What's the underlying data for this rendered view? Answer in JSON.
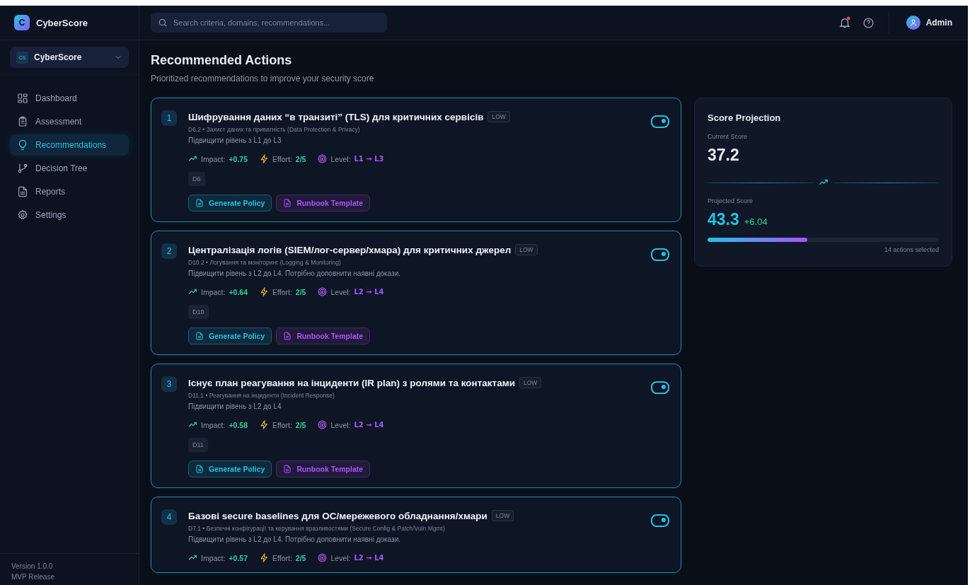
{
  "brand": {
    "logo_letter": "C",
    "name": "CyberScore"
  },
  "workspace": {
    "badge": "CS",
    "name": "CyberScore"
  },
  "sidebar": {
    "items": [
      {
        "label": "Dashboard",
        "selected": false
      },
      {
        "label": "Assessment",
        "selected": false
      },
      {
        "label": "Recommendations",
        "selected": true
      },
      {
        "label": "Decision Tree",
        "selected": false
      },
      {
        "label": "Reports",
        "selected": false
      },
      {
        "label": "Settings",
        "selected": false
      }
    ],
    "footer": [
      "Version 1.0.0",
      "MVP Release"
    ]
  },
  "search": {
    "placeholder": "Search criteria, domains, recommendations..."
  },
  "topbar": {
    "notification_dot": true,
    "user": "Admin"
  },
  "page": {
    "title": "Recommended Actions",
    "subtitle": "Prioritized recommendations to improve your security score"
  },
  "recommendations": [
    {
      "rank": "1",
      "title": "Шифрування даних “в транзиті” (TLS) для критичних сервісів",
      "priority": "LOW",
      "domain": "D6.2 • Захист даних та приватність (Data Protection & Privacy)",
      "description": "Підвищити рівень з L1 до L3",
      "impact_label": "Impact:",
      "impact": "+0.75",
      "effort_label": "Effort:",
      "effort": "2/5",
      "level_label": "Level:",
      "level": "L1 → L3",
      "tag": "D6",
      "actions": [
        "Generate Policy",
        "Runbook Template"
      ],
      "on": true
    },
    {
      "rank": "2",
      "title": "Централізація логів (SIEM/лог-сервер/хмара) для критичних джерел",
      "priority": "LOW",
      "domain": "D10.2 • Логування та моніторинг (Logging & Monitoring)",
      "description": "Підвищити рівень з L2 до L4. Потрібно доповнити наявні докази.",
      "impact_label": "Impact:",
      "impact": "+0.64",
      "effort_label": "Effort:",
      "effort": "2/5",
      "level_label": "Level:",
      "level": "L2 → L4",
      "tag": "D10",
      "actions": [
        "Generate Policy",
        "Runbook Template"
      ],
      "on": true
    },
    {
      "rank": "3",
      "title": "Існує план реагування на інциденти (IR plan) з ролями та контактами",
      "priority": "LOW",
      "domain": "D11.1 • Реагування на інциденти (Incident Response)",
      "description": "Підвищити рівень з L2 до L4",
      "impact_label": "Impact:",
      "impact": "+0.58",
      "effort_label": "Effort:",
      "effort": "2/5",
      "level_label": "Level:",
      "level": "L2 → L4",
      "tag": "D11",
      "actions": [
        "Generate Policy",
        "Runbook Template"
      ],
      "on": true
    },
    {
      "rank": "4",
      "title": "Базові secure baselines для ОС/мережевого обладнання/хмари",
      "priority": "LOW",
      "domain": "D7.1 • Безпечні конфігурації та керування вразливостями (Secure Config & Patch/Vuln Mgmt)",
      "description": "Підвищити рівень з L2 до L4. Потрібно доповнити наявні докази.",
      "impact_label": "Impact:",
      "impact": "+0.57",
      "effort_label": "Effort:",
      "effort": "2/5",
      "level_label": "Level:",
      "level": "L2 → L4",
      "on": true
    }
  ],
  "projection": {
    "title": "Score Projection",
    "current_label": "Current Score",
    "current": "37.2",
    "projected_label": "Projected Score",
    "projected": "43.3",
    "delta": "+6.04",
    "level": 0.43,
    "selected_text": "14 actions selected"
  }
}
